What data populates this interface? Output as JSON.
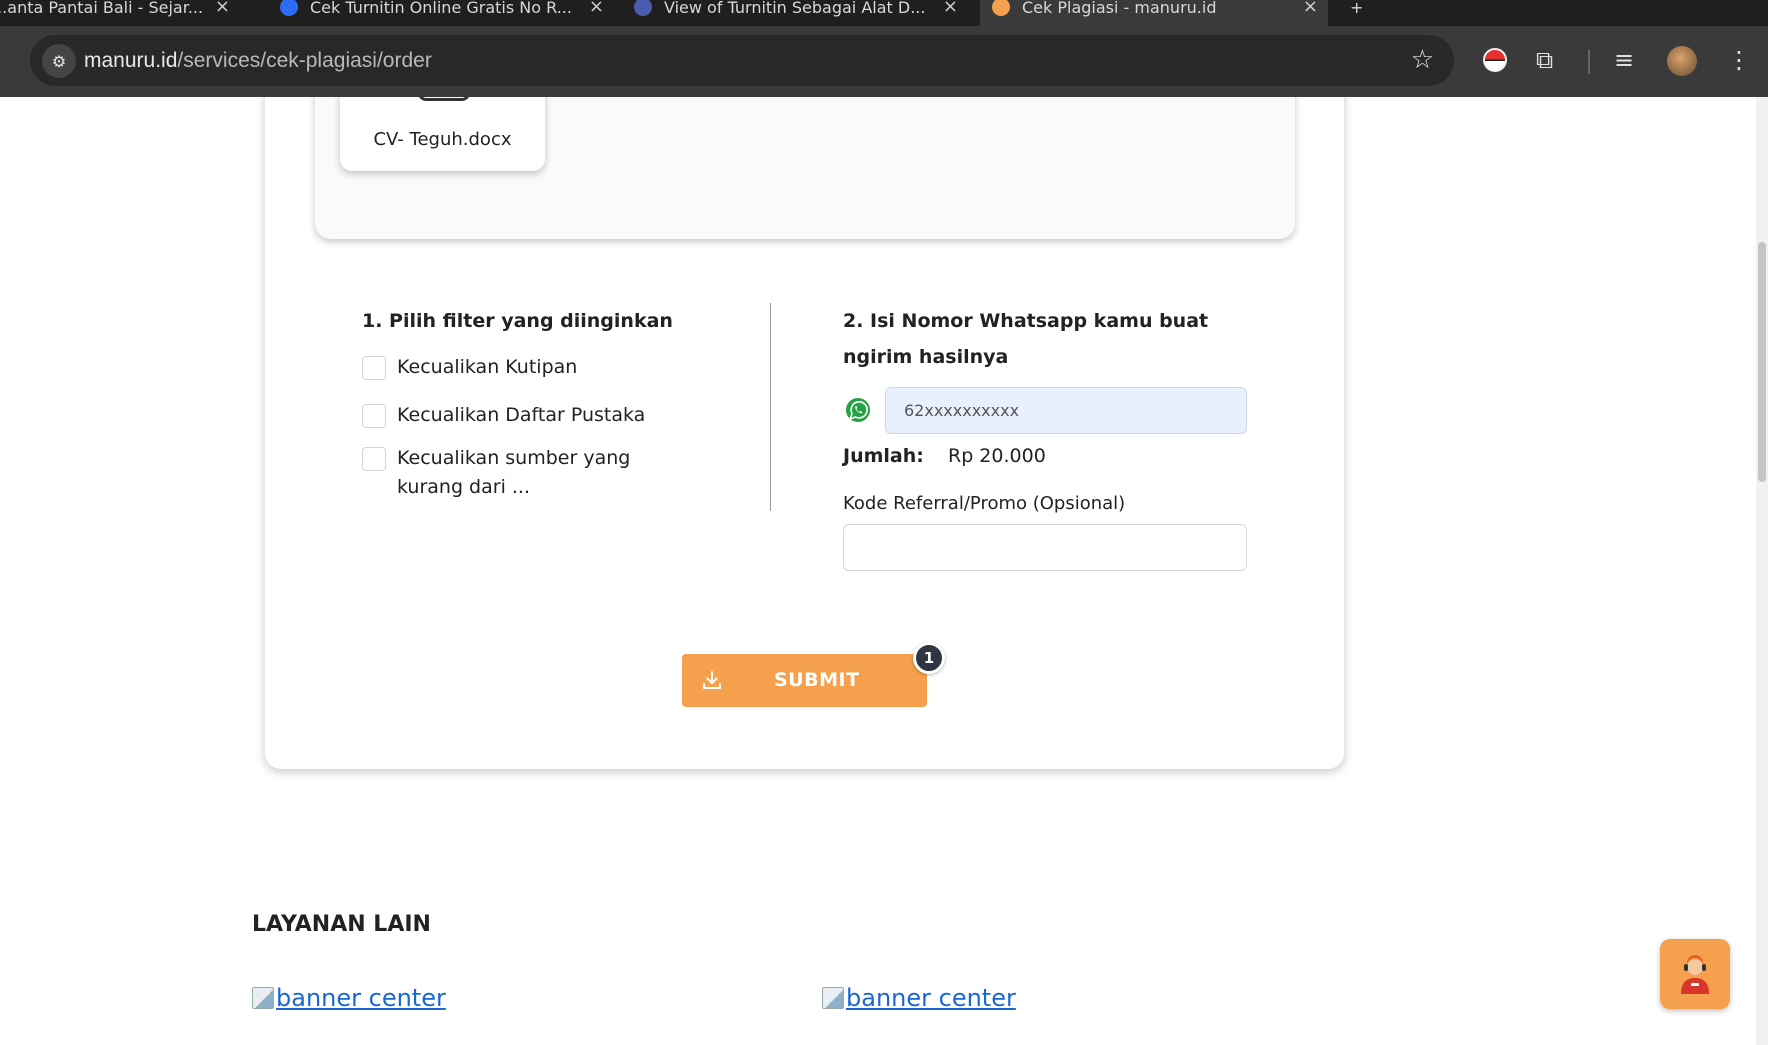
{
  "browser": {
    "tabs": [
      {
        "title": "...anta Pantai Bali - Sejar...",
        "favicon_color": "#888888",
        "active": false
      },
      {
        "title": "Cek Turnitin Online Gratis No R...",
        "favicon_color": "#2f6cf6",
        "active": false
      },
      {
        "title": "View of Turnitin Sebagai Alat D...",
        "favicon_color": "#4a5cae",
        "active": false
      },
      {
        "title": "Cek Plagiasi - manuru.id",
        "favicon_color": "#f5a04c",
        "active": true
      }
    ],
    "new_tab_label": "+",
    "url_host": "manuru.id",
    "url_path": "/services/cek-plagiasi/order"
  },
  "upload": {
    "file_name": "CV- Teguh.docx"
  },
  "filters": {
    "title": "1. Pilih filter yang diinginkan",
    "options": [
      {
        "label": "Kecualikan Kutipan",
        "checked": false
      },
      {
        "label": "Kecualikan Daftar Pustaka",
        "checked": false
      },
      {
        "label": "Kecualikan sumber yang kurang dari ...",
        "checked": false
      }
    ]
  },
  "contact": {
    "title": "2. Isi Nomor Whatsapp kamu buat ngirim hasilnya",
    "phone_placeholder": "62xxxxxxxxxx",
    "amount_label": "Jumlah:",
    "amount_value": "Rp 20.000",
    "referral_label": "Kode Referral/Promo (Opsional)",
    "referral_value": ""
  },
  "submit": {
    "label": "SUBMIT",
    "badge_count": "1"
  },
  "other_services": {
    "title": "LAYANAN LAIN",
    "banners": [
      {
        "alt_text": "banner center"
      },
      {
        "alt_text": "banner center"
      }
    ]
  },
  "colors": {
    "accent": "#f5a04c",
    "whatsapp": "#25a244",
    "link": "#1a66d2"
  }
}
